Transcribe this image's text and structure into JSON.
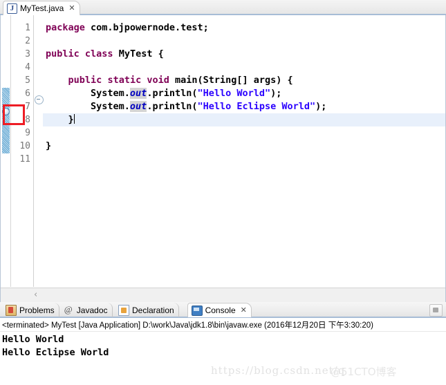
{
  "editor": {
    "tab": {
      "label": "MyTest.java",
      "icon": "java-file-icon",
      "close_glyph": "✕"
    },
    "line_numbers": [
      "1",
      "2",
      "3",
      "4",
      "5",
      "6",
      "7",
      "8",
      "9",
      "10",
      "11"
    ],
    "current_line": "8",
    "breakpoint_line": "6",
    "scroll_chevron": "‹",
    "code_lines": [
      {
        "n": "1",
        "segments": [
          {
            "t": "package",
            "c": "kw"
          },
          {
            "t": " com.bjpowernode.test;",
            "c": "plain"
          }
        ]
      },
      {
        "n": "2",
        "segments": []
      },
      {
        "n": "3",
        "segments": [
          {
            "t": "public",
            "c": "kw"
          },
          {
            "t": " ",
            "c": "plain"
          },
          {
            "t": "class",
            "c": "kw"
          },
          {
            "t": " MyTest {",
            "c": "plain"
          }
        ]
      },
      {
        "n": "4",
        "segments": []
      },
      {
        "n": "5",
        "segments": [
          {
            "t": "    ",
            "c": "plain"
          },
          {
            "t": "public",
            "c": "kw"
          },
          {
            "t": " ",
            "c": "plain"
          },
          {
            "t": "static",
            "c": "kw"
          },
          {
            "t": " ",
            "c": "plain"
          },
          {
            "t": "void",
            "c": "kw"
          },
          {
            "t": " main(String[] args) {",
            "c": "plain"
          }
        ]
      },
      {
        "n": "6",
        "segments": [
          {
            "t": "        System.",
            "c": "plain"
          },
          {
            "t": "out",
            "c": "fld"
          },
          {
            "t": ".println(",
            "c": "plain"
          },
          {
            "t": "\"Hello World\"",
            "c": "str"
          },
          {
            "t": ");",
            "c": "plain"
          }
        ]
      },
      {
        "n": "7",
        "segments": [
          {
            "t": "        System.",
            "c": "plain"
          },
          {
            "t": "out",
            "c": "fld"
          },
          {
            "t": ".println(",
            "c": "plain"
          },
          {
            "t": "\"Hello Eclipse World\"",
            "c": "str"
          },
          {
            "t": ");",
            "c": "plain"
          }
        ]
      },
      {
        "n": "8",
        "segments": [
          {
            "t": "    }",
            "c": "plain"
          }
        ],
        "caret": true
      },
      {
        "n": "9",
        "segments": []
      },
      {
        "n": "10",
        "segments": [
          {
            "t": "}",
            "c": "plain"
          }
        ]
      },
      {
        "n": "11",
        "segments": []
      }
    ]
  },
  "console_panel": {
    "tabs": [
      {
        "label": "Problems",
        "icon": "problems-icon",
        "active": false
      },
      {
        "label": "Javadoc",
        "icon": "javadoc-at-icon",
        "active": false
      },
      {
        "label": "Declaration",
        "icon": "declaration-icon",
        "active": false
      },
      {
        "label": "Console",
        "icon": "console-icon",
        "active": true
      }
    ],
    "close_glyph": "✕",
    "status_line": "<terminated> MyTest [Java Application] D:\\work\\Java\\jdk1.8\\bin\\javaw.exe (2016年12月20日 下午3:30:20)",
    "output_lines": [
      "Hello World",
      "Hello Eclipse World"
    ]
  },
  "watermarks": {
    "csdn": "https://blog.csdn.net/q",
    "cto": "@51CTO博客"
  },
  "colors": {
    "keyword": "#7f0055",
    "string": "#2a00ff",
    "field": "#0000c0",
    "current_line": "#e8f0fb",
    "annotation_box": "#ee1c24",
    "tab_underline": "#a7bcd6"
  }
}
